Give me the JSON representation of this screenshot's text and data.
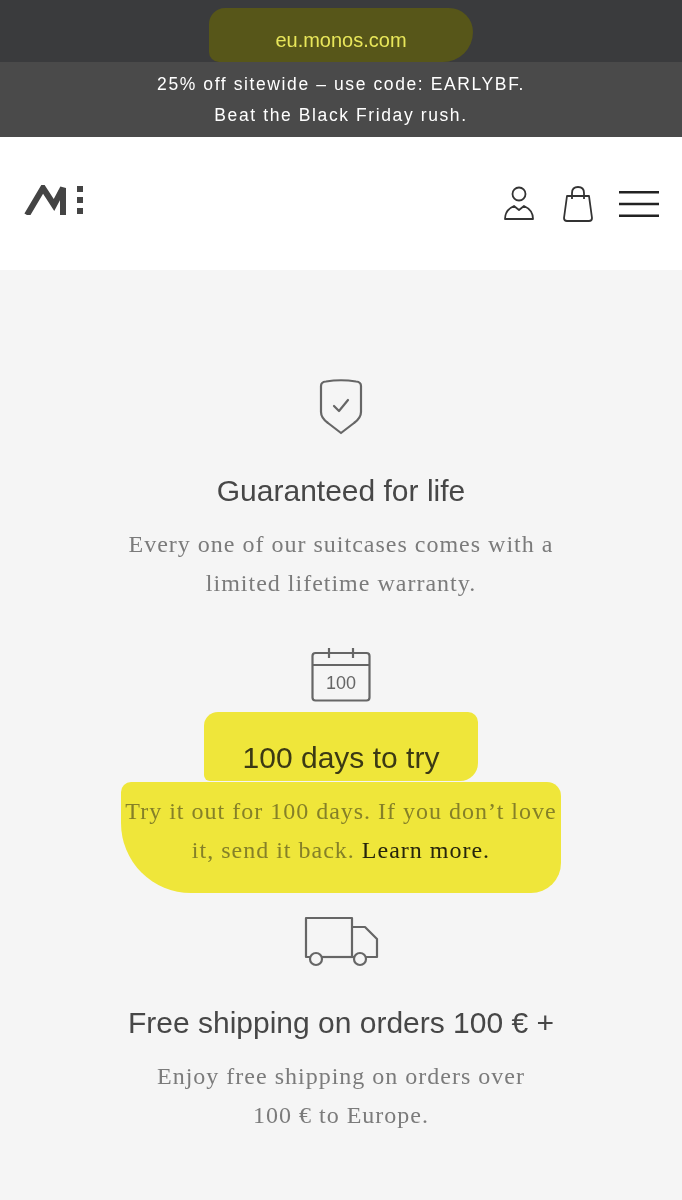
{
  "browser": {
    "url": "eu.monos.com",
    "highlighted": true
  },
  "promo_bar": {
    "text": "25% off sitewide – use code: EARLYBF.\nBeat the Black Friday rush."
  },
  "features": [
    {
      "kind": "shield",
      "title": "Guaranteed for life",
      "description": "Every one of our suitcases comes with a\nlimited lifetime warranty.",
      "highlighted": false
    },
    {
      "kind": "calendar",
      "icon_label": "100",
      "title": "100 days to try",
      "description": "Try it out for 100 days. If you don’t love\nit, send it back.",
      "link": "Learn more.",
      "highlighted": true
    },
    {
      "kind": "truck",
      "title": "Free shipping on orders 100 € +",
      "description": "Enjoy free shipping on orders over\n100 € to Europe.",
      "highlighted": false
    }
  ]
}
